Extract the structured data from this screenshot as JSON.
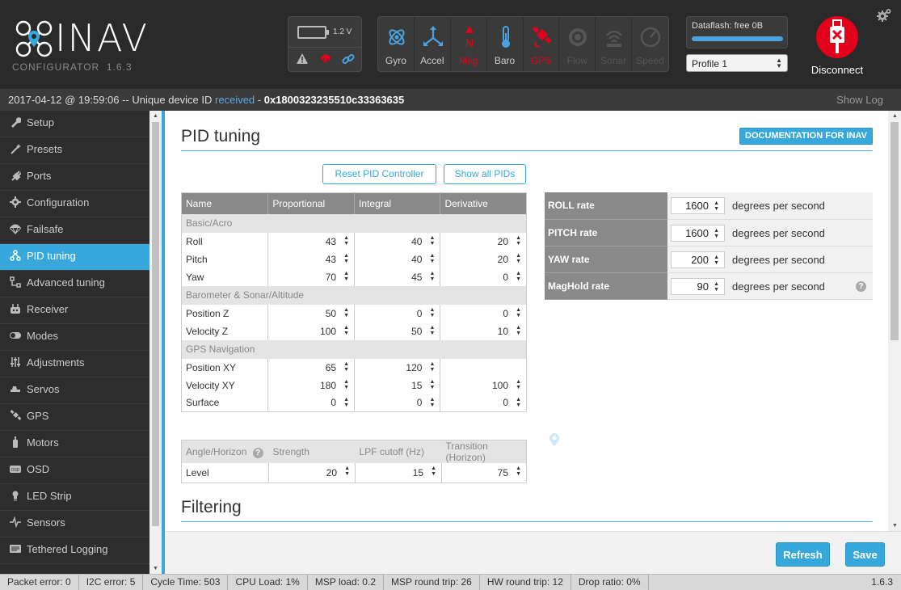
{
  "app": {
    "logo_text": "INAV",
    "configurator_label": "CONFIGURATOR",
    "configurator_version": "1.6.3"
  },
  "battery": {
    "voltage": "1.2 V"
  },
  "sensors": [
    {
      "label": "Gyro",
      "state": "on",
      "icon": "gyro-icon"
    },
    {
      "label": "Accel",
      "state": "on",
      "icon": "accel-icon"
    },
    {
      "label": "Mag",
      "state": "error",
      "icon": "mag-icon"
    },
    {
      "label": "Baro",
      "state": "on",
      "icon": "baro-icon"
    },
    {
      "label": "GPS",
      "state": "error",
      "icon": "gps-icon"
    },
    {
      "label": "Flow",
      "state": "off",
      "icon": "flow-icon"
    },
    {
      "label": "Sonar",
      "state": "off",
      "icon": "sonar-icon"
    },
    {
      "label": "Speed",
      "state": "off",
      "icon": "speed-icon"
    }
  ],
  "dataflash": {
    "label": "Dataflash: free 0B"
  },
  "profile": {
    "selected": "Profile 1"
  },
  "disconnect": {
    "label": "Disconnect"
  },
  "status": {
    "prefix": "2017-04-12 @ 19:59:06 -- Unique device ID ",
    "received": "received",
    "dash": " - ",
    "uid": "0x1800323235510c33363635",
    "show_log": "Show Log"
  },
  "sidebar": {
    "items": [
      {
        "label": "Setup",
        "icon": "wrench-icon"
      },
      {
        "label": "Presets",
        "icon": "wand-icon"
      },
      {
        "label": "Ports",
        "icon": "plug-icon"
      },
      {
        "label": "Configuration",
        "icon": "gear-icon"
      },
      {
        "label": "Failsafe",
        "icon": "parachute-icon"
      },
      {
        "label": "PID tuning",
        "icon": "pid-icon",
        "active": true
      },
      {
        "label": "Advanced tuning",
        "icon": "advanced-icon"
      },
      {
        "label": "Receiver",
        "icon": "receiver-icon"
      },
      {
        "label": "Modes",
        "icon": "toggle-icon"
      },
      {
        "label": "Adjustments",
        "icon": "sliders-icon"
      },
      {
        "label": "Servos",
        "icon": "servo-icon"
      },
      {
        "label": "GPS",
        "icon": "satellite-icon"
      },
      {
        "label": "Motors",
        "icon": "motor-icon"
      },
      {
        "label": "OSD",
        "icon": "osd-icon"
      },
      {
        "label": "LED Strip",
        "icon": "led-icon"
      },
      {
        "label": "Sensors",
        "icon": "pulse-icon"
      },
      {
        "label": "Tethered Logging",
        "icon": "logging-icon"
      }
    ]
  },
  "pid": {
    "title": "PID tuning",
    "doc_button": "DOCUMENTATION FOR INAV",
    "reset_button": "Reset PID Controller",
    "show_all_button": "Show all PIDs",
    "headers": [
      "Name",
      "Proportional",
      "Integral",
      "Derivative"
    ],
    "sections": [
      {
        "title": "Basic/Acro",
        "rows": [
          {
            "name": "Roll",
            "p": "43",
            "i": "40",
            "d": "20"
          },
          {
            "name": "Pitch",
            "p": "43",
            "i": "40",
            "d": "20"
          },
          {
            "name": "Yaw",
            "p": "70",
            "i": "45",
            "d": "0"
          }
        ]
      },
      {
        "title": "Barometer & Sonar/Altitude",
        "rows": [
          {
            "name": "Position Z",
            "p": "50",
            "i": "0",
            "d": "0"
          },
          {
            "name": "Velocity Z",
            "p": "100",
            "i": "50",
            "d": "10"
          }
        ]
      },
      {
        "title": "GPS Navigation",
        "rows": [
          {
            "name": "Position XY",
            "p": "65",
            "i": "120",
            "d": ""
          },
          {
            "name": "Velocity XY",
            "p": "180",
            "i": "15",
            "d": "100"
          },
          {
            "name": "Surface",
            "p": "0",
            "i": "0",
            "d": "0"
          }
        ]
      }
    ],
    "angle": {
      "headers": [
        "Angle/Horizon",
        "Strength",
        "LPF cutoff (Hz)",
        "Transition (Horizon)"
      ],
      "row": {
        "name": "Level",
        "strength": "20",
        "lpf": "15",
        "transition": "75"
      }
    },
    "rates": [
      {
        "name": "ROLL rate",
        "value": "1600",
        "unit": "degrees per second"
      },
      {
        "name": "PITCH rate",
        "value": "1600",
        "unit": "degrees per second"
      },
      {
        "name": "YAW rate",
        "value": "200",
        "unit": "degrees per second"
      },
      {
        "name": "MagHold rate",
        "value": "90",
        "unit": "degrees per second"
      }
    ],
    "filtering_title": "Filtering"
  },
  "bottom": {
    "refresh": "Refresh",
    "save": "Save"
  },
  "footer": {
    "packet_error": "Packet error: 0",
    "i2c_error": "I2C error: 5",
    "cycle_time": "Cycle Time: 503",
    "cpu_load": "CPU Load: 1%",
    "msp_load": "MSP load: 0.2",
    "msp_round_trip": "MSP round trip: 26",
    "hw_round_trip": "HW round trip: 12",
    "drop_ratio": "Drop ratio: 0%",
    "version": "1.6.3"
  },
  "colors": {
    "accent": "#37a8db",
    "error": "#e2001a",
    "header_bg": "#2a2a2a"
  }
}
